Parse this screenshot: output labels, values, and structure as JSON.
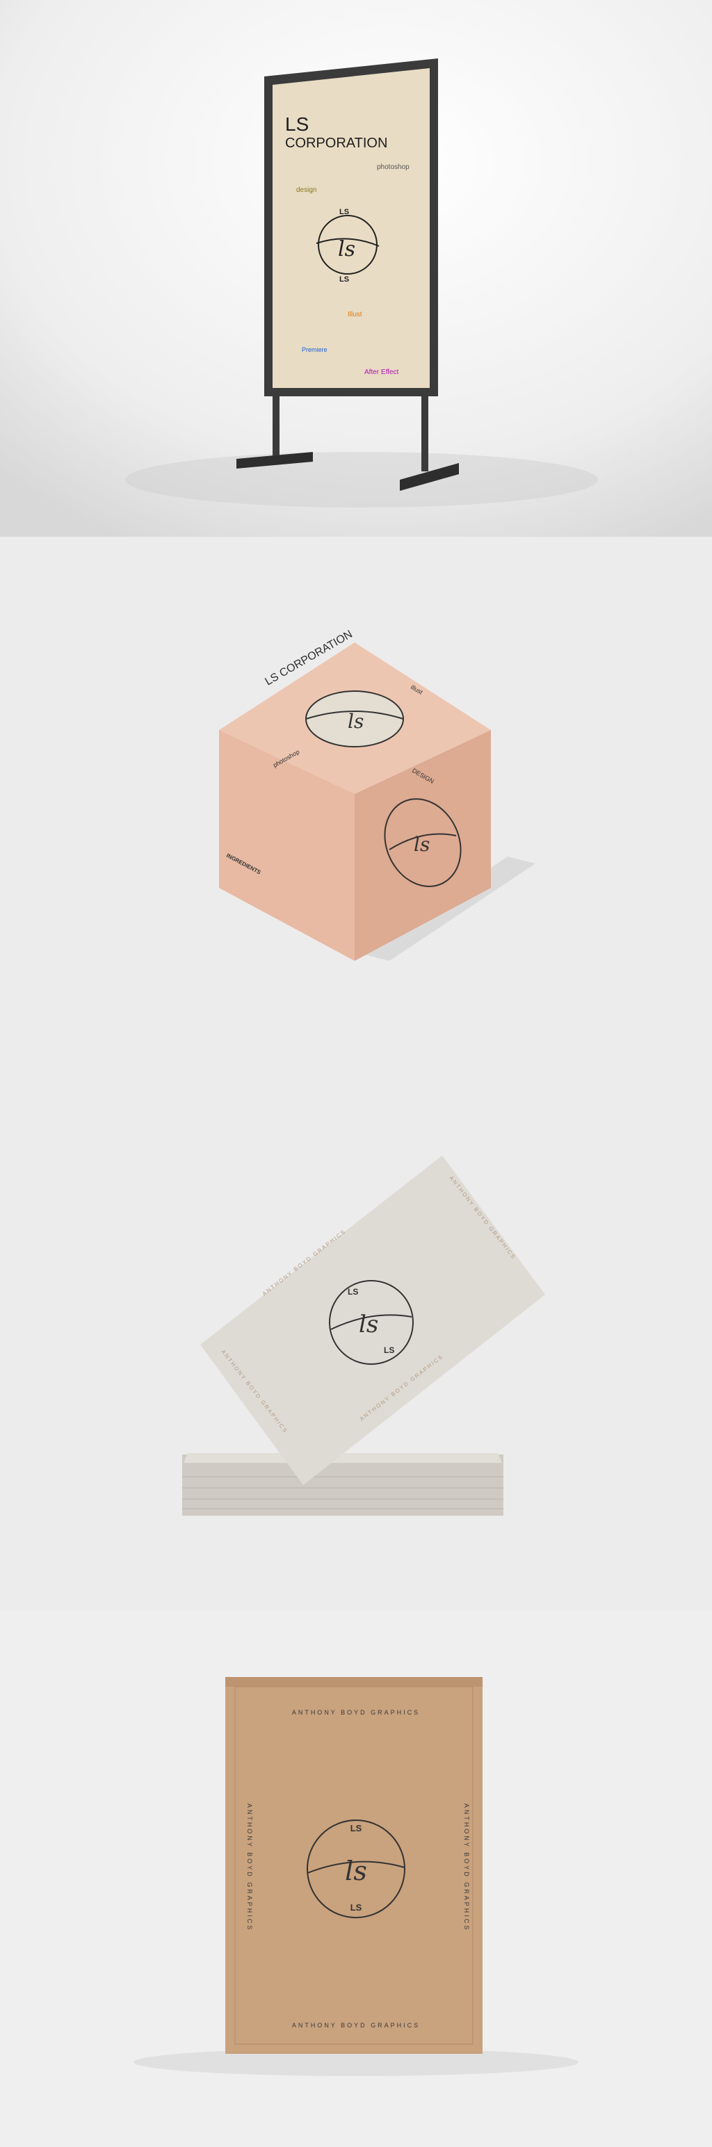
{
  "signboard": {
    "title_line1": "LS",
    "title_line2": "CORPORATION",
    "tags": {
      "photoshop": "photoshop",
      "design": "design",
      "illustrator": "Illust",
      "premiere": "Premiere",
      "after_effect": "After Effect"
    }
  },
  "cube_box": {
    "title": "LS CORPORATION",
    "tag_left": "photoshop",
    "tag_right_top": "illust",
    "tag_right_bottom": "DESIGN",
    "ingredients_label": "INGREDIENTS"
  },
  "business_card": {
    "edge_text": "ANTHONY BOYD GRAPHICS"
  },
  "mailer_box": {
    "edge_text": "ANTHONY BOYD GRAPHICS"
  },
  "logo": {
    "monogram": "ls",
    "top": "LS",
    "bottom": "LS"
  },
  "colors": {
    "poster_bg": "#e8dcc4",
    "cube_box": "#e8b9a3",
    "card": "#dedbd5",
    "kraft": "#c9a27e",
    "ink": "#2e3440"
  }
}
